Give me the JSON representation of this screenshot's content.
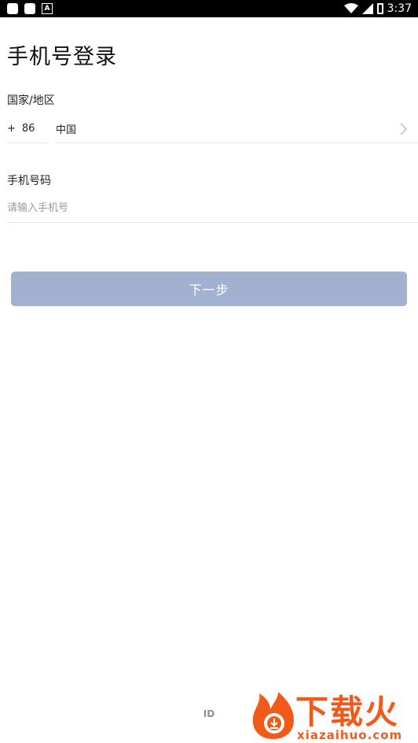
{
  "status_bar": {
    "time": "3:37",
    "left_icons": [
      "square-icon",
      "square-icon",
      "a-icon"
    ],
    "right_icons": [
      "wifi-icon",
      "signal-icon",
      "battery-icon"
    ]
  },
  "page": {
    "title": "手机号登录"
  },
  "region": {
    "label": "国家/地区",
    "code_prefix": "+",
    "code": "86",
    "country": "中国"
  },
  "phone": {
    "label": "手机号码",
    "value": "",
    "placeholder": "请输入手机号"
  },
  "next_button": {
    "label": "下一步",
    "color": "#a3b1d0"
  },
  "footer": {
    "text": "ID"
  },
  "watermark": {
    "text": "下载火",
    "subtext": "xiazaihuo.com",
    "color": "#f25a1c"
  }
}
